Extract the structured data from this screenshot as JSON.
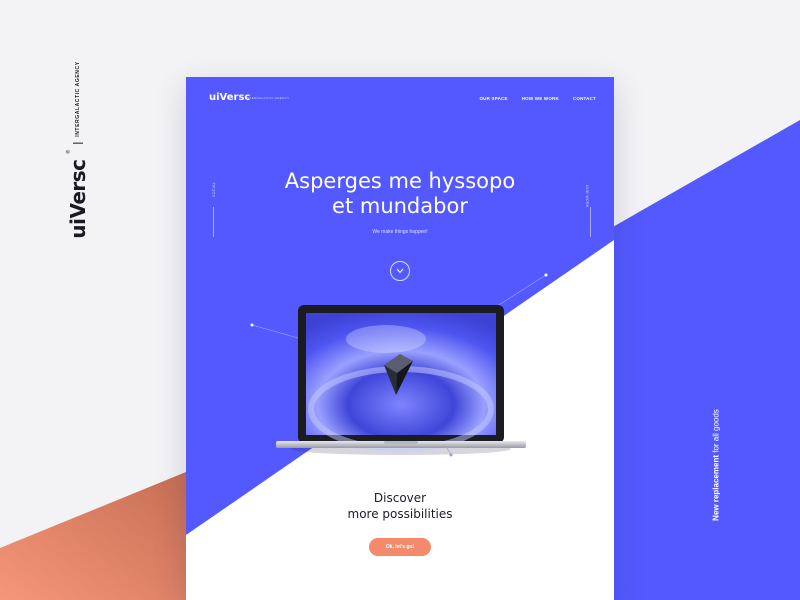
{
  "brand": {
    "logo": "uiVersc",
    "registered": "®",
    "tagline": "INTERGALACTIC AGENCY"
  },
  "right_tagline": {
    "bold": "New replacement",
    "rest": " for all goods"
  },
  "page": {
    "nav": {
      "logo": "uiVersc",
      "sub": "INTERGALACTIC AGENCY",
      "links": [
        "OUR SPACE",
        "HOW WE WORK",
        "CONTACT"
      ]
    },
    "hero": {
      "title_line1": "Asperges me hyssopo",
      "title_line2": "et mundabor",
      "subtitle": "We make things happen!"
    },
    "side_left": "SOCIAL",
    "side_right": "OUR WORK",
    "cta": {
      "line1": "Discover",
      "line2": "more  possibilities",
      "button": "Ok, let's go!"
    }
  },
  "colors": {
    "primary": "#5359ff",
    "accent": "#f4896c",
    "background": "#f3f3f5",
    "text_dark": "#1c1c28"
  },
  "icons": {
    "scroll": "chevron-down-icon",
    "shape": "cube-icon"
  }
}
